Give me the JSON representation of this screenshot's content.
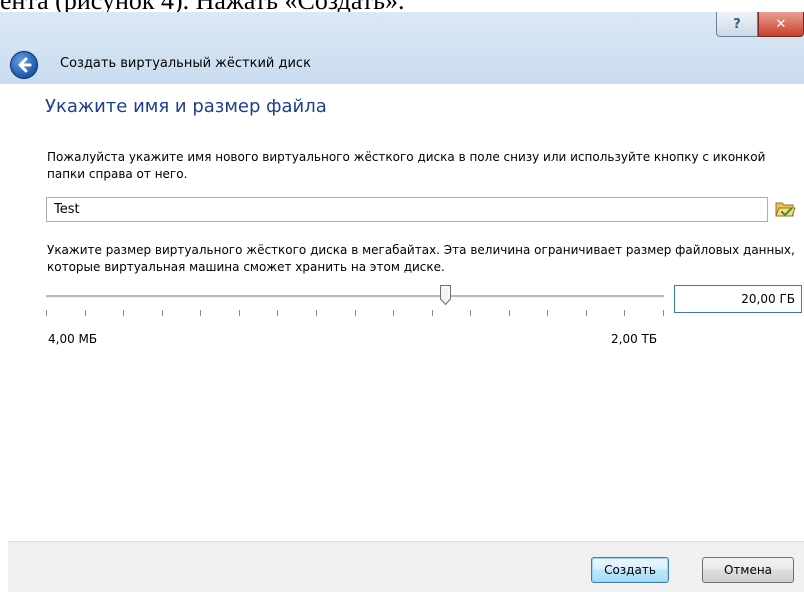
{
  "background_doc": {
    "text": "ента (рисунок 4). Нажать «Создать»."
  },
  "window": {
    "help_label": "?",
    "close_label": "✕",
    "title": "Создать виртуальный жёсткий диск"
  },
  "page": {
    "heading": "Укажите имя и размер файла",
    "name_description": "Пожалуйста укажите имя нового виртуального жёсткого диска в поле снизу или используйте кнопку с иконкой папки справа от него.",
    "name_value": "Test",
    "size_description": "Укажите размер виртуального жёсткого диска в мегабайтах. Эта величина ограничивает размер файловых данных, которые виртуальная машина сможет хранить на этом диске.",
    "slider": {
      "min_label": "4,00 МБ",
      "max_label": "2,00 ТБ",
      "position_fraction": 0.645,
      "tick_count": 17
    },
    "size_value": "20,00 ГБ"
  },
  "buttons": {
    "create": "Создать",
    "cancel": "Отмена"
  },
  "icons": {
    "back": "back-arrow-icon",
    "folder": "folder-open-icon"
  },
  "colors": {
    "heading": "#1e3f8f",
    "caption": "#c9dcef",
    "footer": "#f0f0f0",
    "accent": "#3c7fb1"
  }
}
